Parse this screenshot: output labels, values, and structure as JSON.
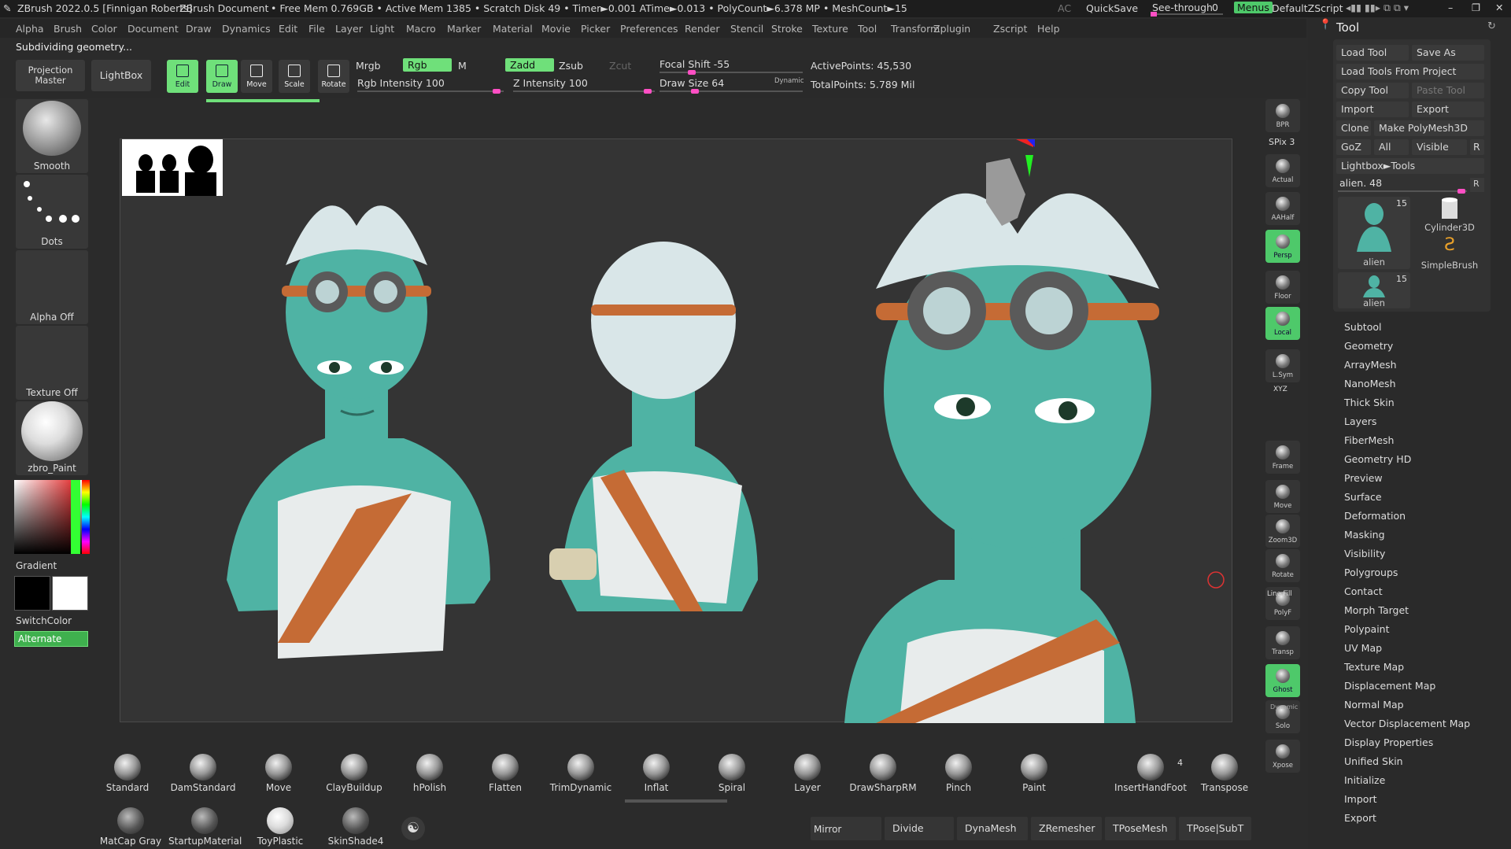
{
  "app": {
    "title_line": "ZBrush 2022.0.5 [Finnigan Roberts]",
    "document": "ZBrush Document",
    "stats": "• Free Mem 0.769GB • Active Mem 1385 • Scratch Disk 49 • Timer►0.001 ATime►0.013 • PolyCount►6.378 MP • MeshCount►15",
    "ac": "AC",
    "quicksave": "QuickSave",
    "see_through": "See-through",
    "see_through_value": "0",
    "menus": "Menus",
    "zscript": "DefaultZScript",
    "status": "Subdividing geometry..."
  },
  "menu": [
    "Alpha",
    "Brush",
    "Color",
    "Document",
    "Draw",
    "Dynamics",
    "Edit",
    "File",
    "Layer",
    "Light",
    "Macro",
    "Marker",
    "Material",
    "Movie",
    "Picker",
    "Preferences",
    "Render",
    "Stencil",
    "Stroke",
    "Texture",
    "Tool",
    "Transform",
    "Zplugin",
    "Zscript",
    "Help"
  ],
  "shelf": {
    "projection_master": "Projection Master",
    "lightbox": "LightBox",
    "tools": [
      {
        "label": "Edit",
        "active": true
      },
      {
        "label": "Draw",
        "active": true
      },
      {
        "label": "Move",
        "active": false
      },
      {
        "label": "Scale",
        "active": false
      },
      {
        "label": "Rotate",
        "active": false
      }
    ],
    "mrgb": "Mrgb",
    "rgb": "Rgb",
    "m": "M",
    "zadd": "Zadd",
    "zsub": "Zsub",
    "zcut": "Zcut",
    "rgb_intensity": "Rgb Intensity 100",
    "z_intensity": "Z Intensity 100",
    "focal_shift": "Focal Shift -55",
    "draw_size": "Draw Size 64",
    "dynamic": "Dynamic",
    "active_points": "ActivePoints: 45,530",
    "total_points": "TotalPoints: 5.789 Mil"
  },
  "left": {
    "brush": "Smooth",
    "stroke": "Dots",
    "alpha": "Alpha Off",
    "texture": "Texture Off",
    "material": "zbro_Paint",
    "gradient": "Gradient",
    "switchcolor": "SwitchColor",
    "alternate": "Alternate"
  },
  "nav": [
    {
      "label": "BPR",
      "active": false
    },
    {
      "label": "Actual",
      "active": false
    },
    {
      "label": "AAHalf",
      "active": false
    },
    {
      "label": "Persp",
      "active": true
    },
    {
      "label": "Floor",
      "active": false
    },
    {
      "label": "Local",
      "active": true
    },
    {
      "label": "L.Sym",
      "active": false
    },
    {
      "label": "Frame",
      "active": false
    },
    {
      "label": "Move",
      "active": false
    },
    {
      "label": "Zoom3D",
      "active": false
    },
    {
      "label": "Rotate",
      "active": false
    },
    {
      "label": "PolyF",
      "active": false
    },
    {
      "label": "Transp",
      "active": false
    },
    {
      "label": "Ghost",
      "active": true
    },
    {
      "label": "Solo",
      "active": false
    },
    {
      "label": "Xpose",
      "active": false
    }
  ],
  "nav_spix": "SPix 3",
  "nav_xyz": "XYZ",
  "nav_linefill": "Line Fill",
  "nav_dynamic": "Dynamic",
  "tool": {
    "title": "Tool",
    "buttons": {
      "load_tool": "Load Tool",
      "save_as": "Save As",
      "load_from_project": "Load Tools From Project",
      "copy_tool": "Copy Tool",
      "paste_tool": "Paste Tool",
      "import": "Import",
      "export": "Export",
      "clone": "Clone",
      "make_polymesh": "Make PolyMesh3D",
      "goz": "GoZ",
      "all": "All",
      "visible": "Visible",
      "r": "R",
      "lightbox_tools": "Lightbox►Tools"
    },
    "current": "alien. 48",
    "thumbs": [
      {
        "name": "alien",
        "count": "15"
      },
      {
        "name": "Cylinder3D",
        "count": ""
      },
      {
        "name": "SimpleBrush",
        "count": ""
      },
      {
        "name": "alien",
        "count": "15"
      }
    ],
    "sections": [
      "Subtool",
      "Geometry",
      "ArrayMesh",
      "NanoMesh",
      "Thick Skin",
      "Layers",
      "FiberMesh",
      "Geometry HD",
      "Preview",
      "Surface",
      "Deformation",
      "Masking",
      "Visibility",
      "Polygroups",
      "Contact",
      "Morph Target",
      "Polypaint",
      "UV Map",
      "Texture Map",
      "Displacement Map",
      "Normal Map",
      "Vector Displacement Map",
      "Display Properties",
      "Unified Skin",
      "Initialize",
      "Import",
      "Export"
    ]
  },
  "brushes": [
    "Standard",
    "DamStandard",
    "Move",
    "ClayBuildup",
    "hPolish",
    "Flatten",
    "TrimDynamic",
    "Inflat",
    "Spiral",
    "Layer",
    "DrawSharpRM",
    "Pinch",
    "Paint",
    "InsertHandFoot",
    "Transpose"
  ],
  "insert_count": "4",
  "materials": [
    "MatCap Gray",
    "StartupMaterial",
    "ToyPlastic",
    "SkinShade4"
  ],
  "bottom_buttons": {
    "mirror": "Mirror",
    "divide": "Divide",
    "dynamesh": "DynaMesh",
    "zremesher": "ZRemesher",
    "tposemesh": "TPoseMesh",
    "tpose_subt": "TPose|SubT"
  },
  "colors": {
    "accent_green": "#6fe07a",
    "slider_pink": "#ff4fc4",
    "skin": "#4fb3a4",
    "strap": "#c56b35",
    "hair": "#d9e6e8",
    "goggle": "#5a5a5a"
  }
}
